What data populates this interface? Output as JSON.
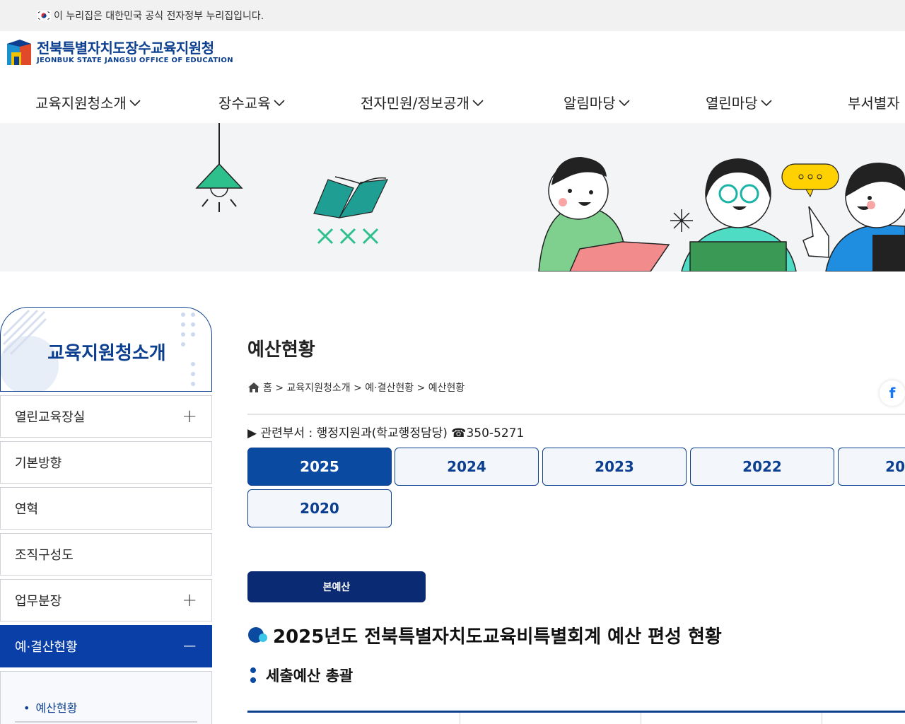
{
  "gov_bar": {
    "text": "이 누리집은 대한민국 공식 전자정부 누리집입니다."
  },
  "logo": {
    "ko": "전북특별자치도장수교육지원청",
    "en": "JEONBUK STATE JANGSU OFFICE OF EDUCATION"
  },
  "gnb": {
    "items": [
      {
        "label": "교육지원청소개"
      },
      {
        "label": "장수교육"
      },
      {
        "label": "전자민원/정보공개"
      },
      {
        "label": "알림마당"
      },
      {
        "label": "열린마당"
      },
      {
        "label": "부서별자"
      }
    ]
  },
  "sidebar": {
    "title": "교육지원청소개",
    "items": [
      {
        "label": "열린교육장실",
        "toggle": "+"
      },
      {
        "label": "기본방향",
        "toggle": ""
      },
      {
        "label": "연혁",
        "toggle": ""
      },
      {
        "label": "조직구성도",
        "toggle": ""
      },
      {
        "label": "업무분장",
        "toggle": "+"
      },
      {
        "label": "예·결산현황",
        "toggle": "−"
      }
    ],
    "sub_items": [
      {
        "label": "예산현황"
      }
    ]
  },
  "content": {
    "page_title": "예산현황",
    "breadcrumb": "홈 > 교육지원청소개 > 예·결산현황 > 예산현황",
    "facebook": "f",
    "dept": "▶ 관련부서 : 행정지원과(학교행정담당) ☎350-5271",
    "years": [
      "2025",
      "2024",
      "2023",
      "2022",
      "20",
      "2020"
    ],
    "tab_main": "본예산",
    "heading": "2025년도 전북특별자치도교육비특별회계 예산 편성 현황",
    "subheading": "세출예산 총괄"
  },
  "colors": {
    "primary": "#0c3f8f",
    "active": "#0a3fa8",
    "dark_tab": "#0a2a73"
  }
}
